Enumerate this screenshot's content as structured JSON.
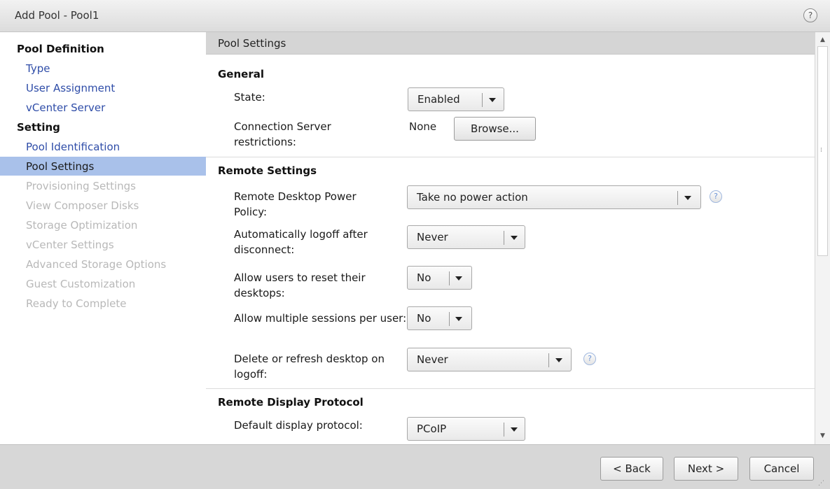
{
  "window": {
    "title": "Add Pool - Pool1",
    "help_icon": "?"
  },
  "nav": {
    "heading_definition": "Pool Definition",
    "definition_items": [
      "Type",
      "User Assignment",
      "vCenter Server"
    ],
    "heading_setting": "Setting",
    "setting_items": [
      {
        "label": "Pool Identification",
        "state": "enabled"
      },
      {
        "label": "Pool Settings",
        "state": "selected"
      },
      {
        "label": "Provisioning Settings",
        "state": "disabled"
      },
      {
        "label": "View Composer Disks",
        "state": "disabled"
      },
      {
        "label": "Storage Optimization",
        "state": "disabled"
      },
      {
        "label": "vCenter Settings",
        "state": "disabled"
      },
      {
        "label": "Advanced Storage Options",
        "state": "disabled"
      },
      {
        "label": "Guest Customization",
        "state": "disabled"
      },
      {
        "label": "Ready to Complete",
        "state": "disabled"
      }
    ]
  },
  "content": {
    "header": "Pool Settings",
    "general": {
      "title": "General",
      "state_label": "State:",
      "state_value": "Enabled",
      "restrictions_label": "Connection Server restrictions:",
      "restrictions_value": "None",
      "browse_label": "Browse..."
    },
    "remote": {
      "title": "Remote Settings",
      "power_label": "Remote Desktop Power Policy:",
      "power_value": "Take no power action",
      "logoff_label": "Automatically logoff after disconnect:",
      "logoff_value": "Never",
      "reset_label": "Allow users to reset their desktops:",
      "reset_value": "No",
      "multi_label": "Allow multiple sessions per user:",
      "multi_value": "No",
      "delete_label": "Delete or refresh desktop on logoff:",
      "delete_value": "Never"
    },
    "display": {
      "title": "Remote Display Protocol",
      "protocol_label": "Default display protocol:",
      "protocol_value": "PCoIP"
    }
  },
  "footer": {
    "back_label": "< Back",
    "next_label": "Next >",
    "cancel_label": "Cancel"
  },
  "colors": {
    "selected_nav": "#a9c1ea",
    "link": "#2f4da8",
    "disabled": "#b8b8b8",
    "help_icon": "#6b93d6"
  }
}
